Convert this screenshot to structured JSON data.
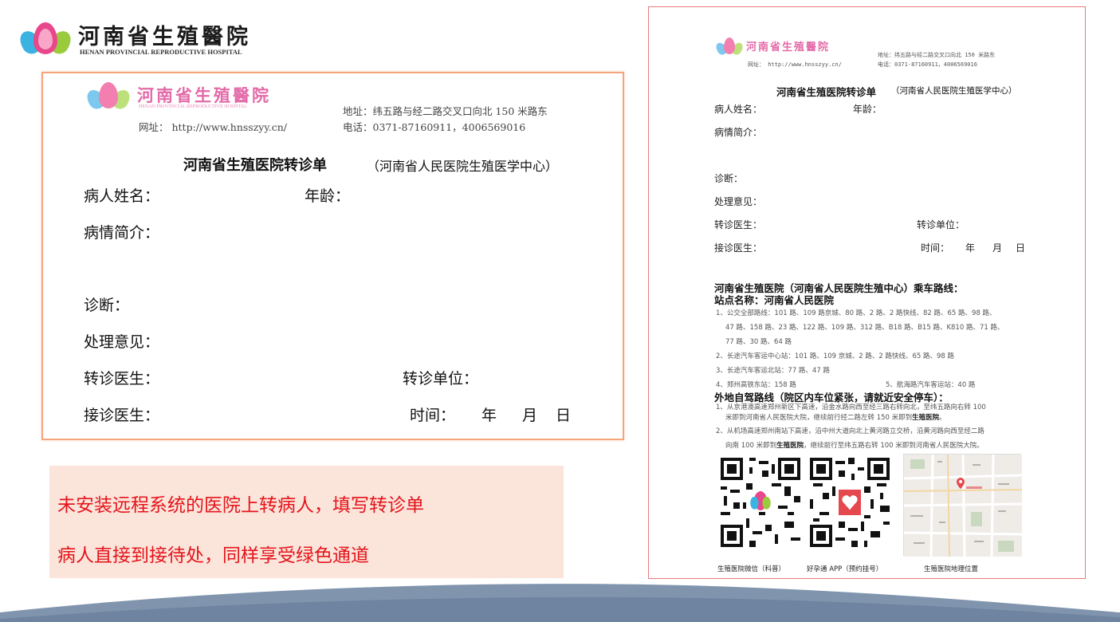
{
  "header": {
    "logo_cn": "河南省生殖醫院",
    "logo_en": "HENAN PROVINCIAL REPRODUCTIVE HOSPITAL"
  },
  "form": {
    "logo_cn": "河南省生殖醫院",
    "logo_en": "HENAN PROVINCIAL REPRODUCTIVE HOSPITAL",
    "address": "地址：纬五路与经二路交叉口向北 150 米路东",
    "website": "网址： http://www.hnsszyy.cn/",
    "phone": "电话：0371-87160911，4006569016",
    "title": "河南省生殖医院转诊单",
    "subtitle": "（河南省人民医院生殖医学中心）",
    "fields": {
      "name": "病人姓名：",
      "age": "年龄：",
      "history": "病情简介：",
      "diagnosis": "诊断：",
      "treatment": "处理意见：",
      "referring_doctor": "转诊医生：",
      "referring_unit": "转诊单位：",
      "receiving_doctor": "接诊医生：",
      "time": "时间：",
      "year": "年",
      "month": "月",
      "day": "日"
    }
  },
  "note": {
    "line1": "未安装远程系统的医院上转病人，填写转诊单",
    "line2": "病人直接到接待处，同样享受绿色通道"
  },
  "doc": {
    "logo_cn": "河南省生殖醫院",
    "website": "网址： http://www.hnsszyy.cn/",
    "address": "地址：纬五路与经二路交叉口向北 150 米路东",
    "phone": "电话：0371-87160911，4006569016",
    "title": "河南省生殖医院转诊单",
    "subtitle": "（河南省人民医院生殖医学中心）",
    "fields": {
      "name": "病人姓名：",
      "age": "年龄：",
      "history": "病情简介：",
      "diagnosis": "诊断：",
      "treatment": "处理意见：",
      "referring_doctor": "转诊医生：",
      "referring_unit": "转诊单位：",
      "receiving_doctor": "接诊医生：",
      "time": "时间：",
      "year": "年",
      "month": "月",
      "day": "日"
    },
    "bus_heading": "河南省生殖医院（河南省人民医院生殖中心）乘车路线：",
    "station_heading": "站点名称：河南省人民医院",
    "bus_routes": [
      "1、公交全部路线：101 路、109 路京城、80 路、2 路、2 路快线、82 路、65 路、98 路、",
      "47 路、158 路、23 路、122 路、109 路、312 路、B18 路、B15 路、K810 路、71 路、",
      "77 路、30 路、64 路",
      "2、长途汽车客运中心站：101 路、109 京城、2 路、2 路快线、65 路、98 路",
      "3、长途汽车客运北站：77 路、47 路",
      "4、郑州高铁东站：158 路",
      "5、航海路汽车客运站：40 路"
    ],
    "drive_heading": "外地自驾路线（院区内车位紧张，请就近安全停车）：",
    "drive_routes": [
      "1、从京港澳高速郑州新区下高速，沿金水路向西至经三路右转向北，至纬五路向右转 100",
      "米即到河南省人民医院大院，继续前行经二路左转 150 米即到",
      "生殖医院",
      "。",
      "2、从机场高速郑州南站下高速，沿中州大道向北上黄河路立交桥，沿黄河路向西至经二路",
      "向南 100 米即到",
      "生殖医院",
      "，继续前行至纬五路右转 100 米即到河南省人民医院大院。"
    ],
    "captions": {
      "wechat": "生殖医院微信（科普）",
      "app": "好孕通 APP（预约挂号）",
      "map": "生殖医院地理位置"
    }
  },
  "colors": {
    "form_border": "#f3a57b",
    "doc_border": "#e87a7a",
    "note_bg": "#fbe5db",
    "note_text": "#e5141b",
    "logo_pink": "#e36aa8",
    "wave": "#8095ad"
  }
}
